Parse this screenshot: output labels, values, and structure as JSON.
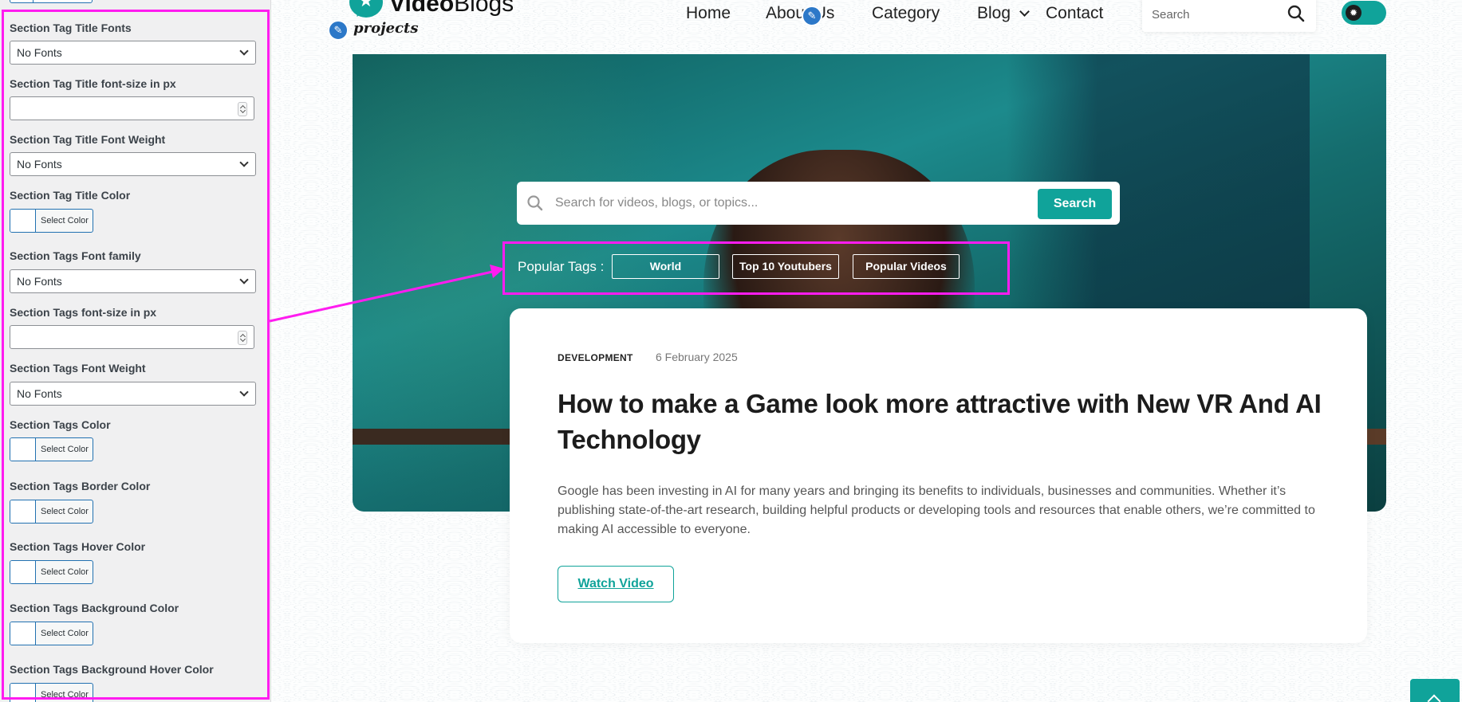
{
  "panel": {
    "fields": [
      {
        "label": "Section Tag Title Fonts",
        "type": "select",
        "value": "No Fonts"
      },
      {
        "label": "Section Tag Title font-size in px",
        "type": "number",
        "value": ""
      },
      {
        "label": "Section Tag Title Font Weight",
        "type": "select",
        "value": "No Fonts"
      },
      {
        "label": "Section Tag Title Color",
        "type": "color",
        "value": "Select Color"
      },
      {
        "label": "Section Tags Font family",
        "type": "select",
        "value": "No Fonts"
      },
      {
        "label": "Section Tags font-size in px",
        "type": "number",
        "value": ""
      },
      {
        "label": "Section Tags Font Weight",
        "type": "select",
        "value": "No Fonts"
      },
      {
        "label": "Section Tags Color",
        "type": "color",
        "value": "Select Color"
      },
      {
        "label": "Section Tags Border Color",
        "type": "color",
        "value": "Select Color"
      },
      {
        "label": "Section Tags Hover Color",
        "type": "color",
        "value": "Select Color"
      },
      {
        "label": "Section Tags Background Color",
        "type": "color",
        "value": "Select Color"
      },
      {
        "label": "Section Tags Background Hover Color",
        "type": "color",
        "value": "Select Color"
      }
    ]
  },
  "header": {
    "logo_bold": "Video",
    "logo_light": "Blogs",
    "sub_logo": "projects",
    "nav": [
      "Home",
      "About Us",
      "Category",
      "Blog",
      "Contact"
    ],
    "search_placeholder": "Search"
  },
  "hero": {
    "search_placeholder": "Search for videos, blogs, or topics...",
    "search_button": "Search",
    "tags_label": "Popular Tags :",
    "tags": [
      "World",
      "Top 10 Youtubers",
      "Popular Videos"
    ]
  },
  "article": {
    "category": "DEVELOPMENT",
    "date": "6 February 2025",
    "title": "How to make a Game look more attractive with New VR And AI Technology",
    "description": "Google has been investing in AI for many years and bringing its benefits to individuals, businesses and communities. Whether it’s publishing state-of-the-art research, building helpful products or developing tools and resources that enable others, we’re committed to making AI accessible to everyone.",
    "cta": "Watch Video"
  },
  "colors": {
    "accent": "#10a39a",
    "highlight": "#ff1cf0",
    "edit_badge": "#2c78c8"
  }
}
